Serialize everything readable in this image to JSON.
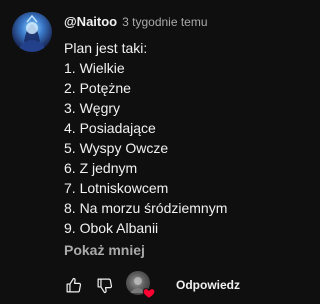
{
  "comment": {
    "author": "@Naitoo",
    "timestamp": "3 tygodnie temu",
    "lines": [
      "Plan jest taki:",
      "1. Wielkie",
      "2. Potężne",
      "3. Węgry",
      "4. Posiadające",
      "5. Wyspy Owcze",
      "6. Z jednym",
      "7. Lotniskowcem",
      "8. Na morzu śródziemnym",
      "9. Obok Albanii"
    ],
    "show_less_label": "Pokaż mniej"
  },
  "actions": {
    "like_icon": "thumb-up-icon",
    "dislike_icon": "thumb-down-icon",
    "creator_heart_icon": "heart-icon",
    "reply_label": "Odpowiedz"
  },
  "colors": {
    "background": "#0f0f0f",
    "text_primary": "#f1f1f1",
    "text_secondary": "#aaaaaa",
    "heart": "#ff0033"
  }
}
